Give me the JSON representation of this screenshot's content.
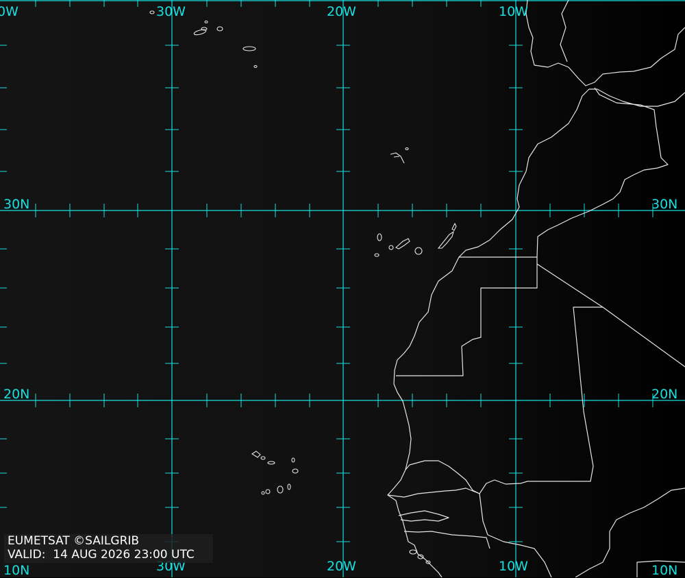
{
  "labels": {
    "top": [
      "30W",
      "20W",
      "10W"
    ],
    "bottom": [
      "30W",
      "20W",
      "10W"
    ],
    "left": [
      "30N",
      "20N"
    ],
    "right": [
      "30N",
      "20N"
    ],
    "corner_top_left": "0W",
    "corner_bottom_left": "10N",
    "corner_bottom_right": "10N"
  },
  "caption": {
    "line1": "EUMETSAT ©SAILGRIB",
    "line2": "VALID:  14 AUG 2026 23:00 UTC"
  },
  "colors": {
    "grid": "#19e0e0",
    "coast": "#e6e6e6",
    "ocean": "#111111"
  }
}
